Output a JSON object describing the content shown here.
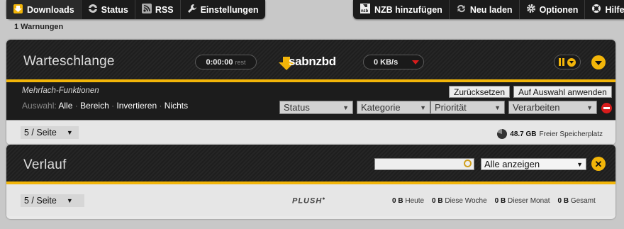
{
  "nav": {
    "downloads": "Downloads",
    "status": "Status",
    "rss": "RSS",
    "settings": "Einstellungen",
    "add_nzb": "NZB hinzufügen",
    "reload": "Neu laden",
    "options": "Optionen",
    "help": "Hilfe"
  },
  "warnings": "1 Warnungen",
  "queue": {
    "title": "Warteschlange",
    "time_left": "0:00:00",
    "time_left_suffix": "rest",
    "logo": "sabnzbd",
    "speed": "0 KB/s",
    "multi_title": "Mehrfach-Funktionen",
    "select_label": "Auswahl:",
    "select_options": [
      "Alle",
      "Bereich",
      "Invertieren",
      "Nichts"
    ],
    "reset_button": "Zurücksetzen",
    "apply_button": "Auf Auswahl anwenden",
    "dropdowns": [
      "Status",
      "Kategorie",
      "Priorität",
      "Verarbeiten"
    ],
    "per_page": "5 / Seite",
    "free_space_value": "48.7 GB",
    "free_space_label": "Freier Speicherplatz"
  },
  "history": {
    "title": "Verlauf",
    "search_placeholder": "",
    "filter": "Alle anzeigen",
    "per_page": "5 / Seite",
    "plush": "PLUSH",
    "stats": [
      {
        "value": "0 B",
        "label": "Heute"
      },
      {
        "value": "0 B",
        "label": "Diese Woche"
      },
      {
        "value": "0 B",
        "label": "Dieser Monat"
      },
      {
        "value": "0 B",
        "label": "Gesamt"
      }
    ]
  },
  "colors": {
    "accent": "#f2b509",
    "nav_bg": "#1b1b1b",
    "red": "#d81c1c"
  }
}
